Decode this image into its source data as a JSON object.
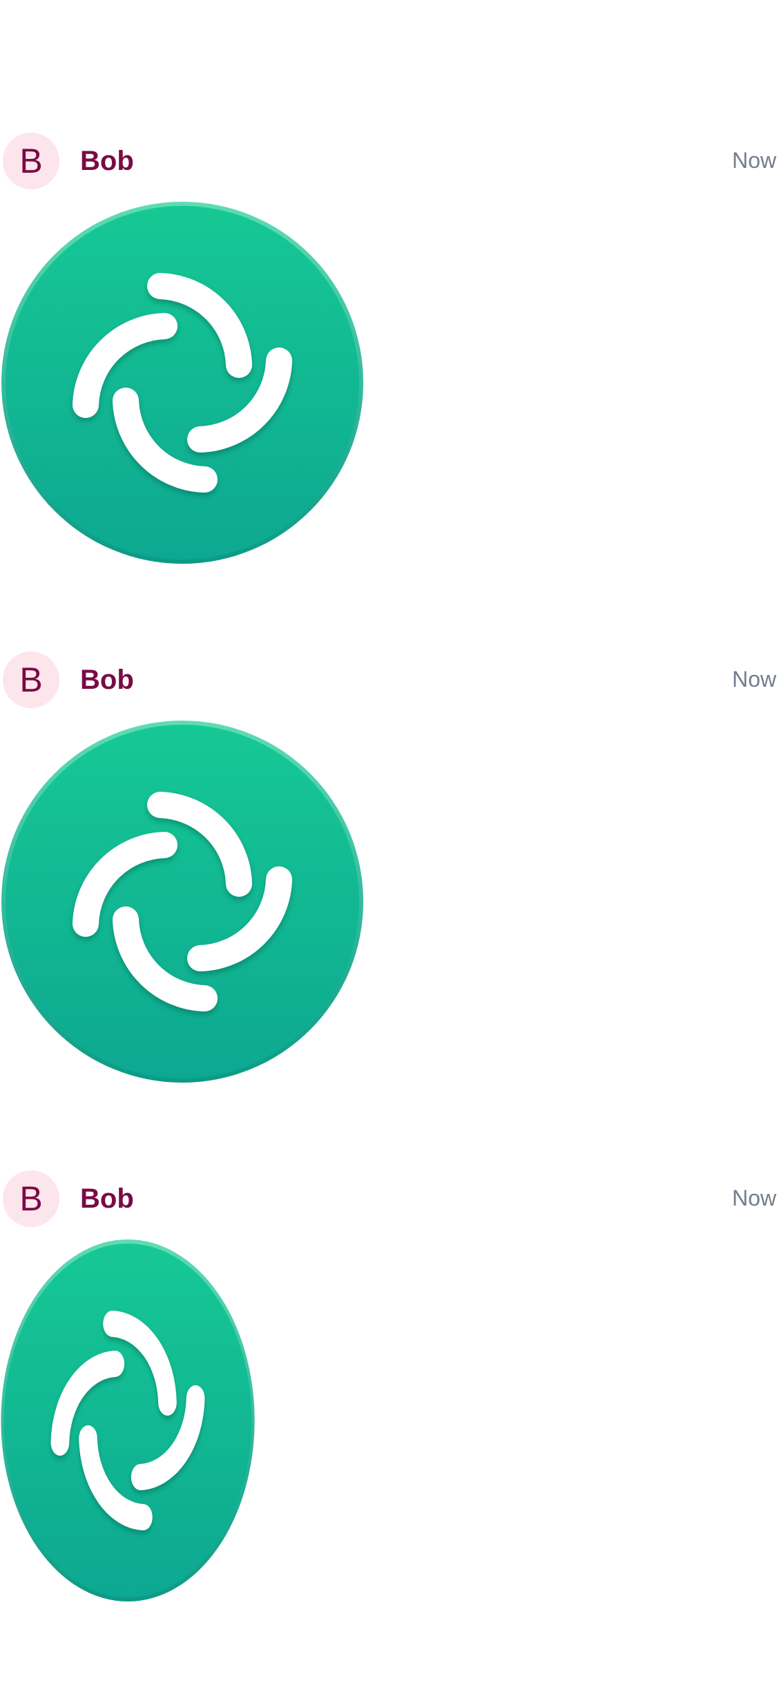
{
  "timeline": {
    "messages": [
      {
        "sender_initial": "B",
        "sender_name": "Bob",
        "timestamp": "Now",
        "attachment": {
          "kind": "image",
          "icon": "element-logo-icon"
        }
      },
      {
        "sender_initial": "B",
        "sender_name": "Bob",
        "timestamp": "Now",
        "attachment": {
          "kind": "image",
          "icon": "element-logo-icon"
        }
      },
      {
        "sender_initial": "B",
        "sender_name": "Bob",
        "timestamp": "Now",
        "attachment": {
          "kind": "image",
          "icon": "element-logo-icon"
        }
      }
    ]
  },
  "colors": {
    "sender_name": "#7a0a45",
    "avatar_background": "#fde5ec",
    "timestamp": "#737d8c",
    "logo_gradient_top": "#16c894",
    "logo_gradient_bottom": "#0da891",
    "logo_rim": "#0b9a85"
  }
}
